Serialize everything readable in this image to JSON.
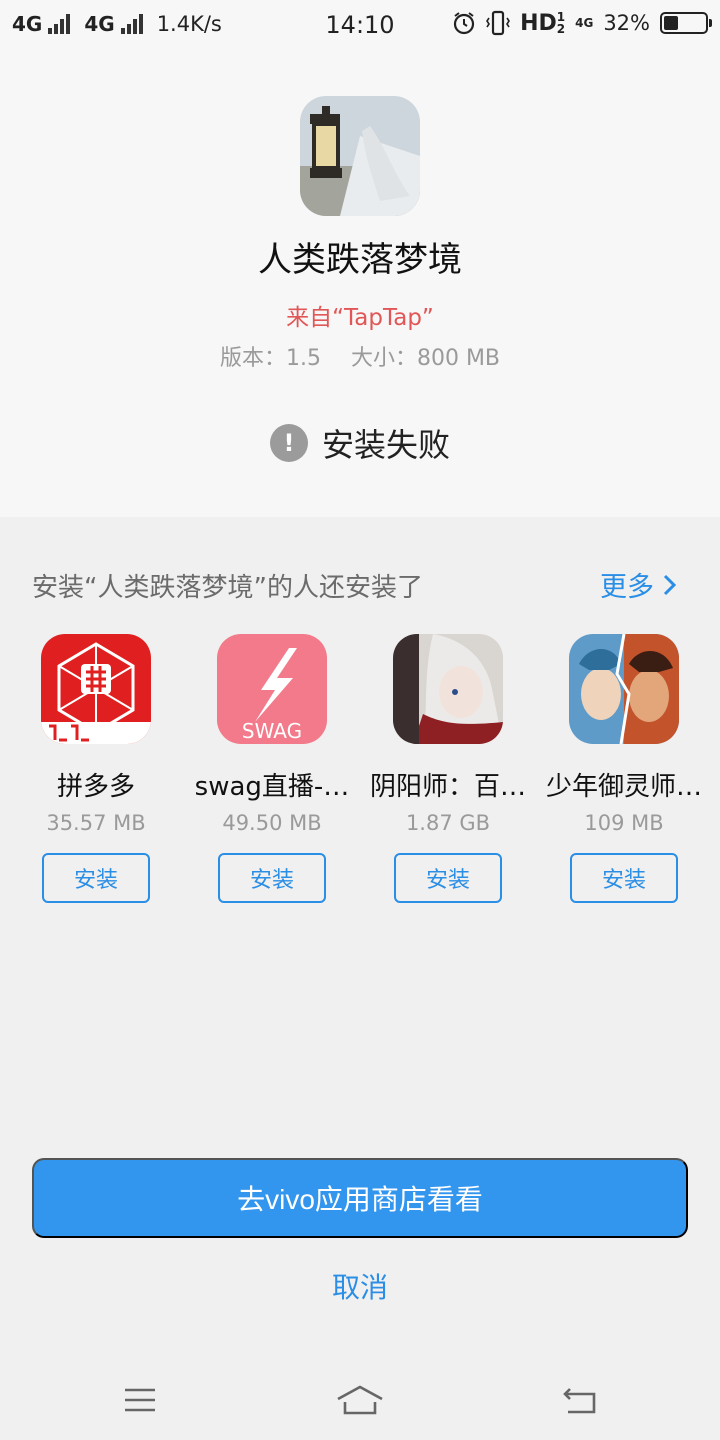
{
  "status_bar": {
    "network1": "4G",
    "network2": "4G",
    "speed": "1.4K/s",
    "time": "14:10",
    "hd": "HD",
    "hd_sub": "1",
    "hd_sub2": "2",
    "net2_label": "4G",
    "battery": "32%",
    "battery_level": 0.32
  },
  "app": {
    "icon": "game-lantern-icon",
    "title": "人类跌落梦境",
    "source": "来自“TapTap”",
    "version": "版本：1.5",
    "size": "大小：800 MB",
    "status_icon": "exclamation-icon",
    "status": "安装失败"
  },
  "recommendations": {
    "header": "安装“人类跌落梦境”的人还安装了",
    "more": "更多",
    "items": [
      {
        "name": "拼多多",
        "size": "35.57 MB",
        "button": "安装",
        "icon": "pinduoduo-icon",
        "color": "#e02020"
      },
      {
        "name": "swag直播-…",
        "size": "49.50 MB",
        "button": "安装",
        "icon": "swag-icon",
        "color": "#f27a8a",
        "icon_text": "SWAG"
      },
      {
        "name": "阴阳师：百…",
        "size": "1.87 GB",
        "button": "安装",
        "icon": "onmyoji-icon",
        "color": "#5a4a4e"
      },
      {
        "name": "少年御灵师…",
        "size": "109 MB",
        "button": "安装",
        "icon": "spirit-master-icon",
        "color": "#4a7fa8"
      }
    ]
  },
  "actions": {
    "store_button": "去vivo应用商店看看",
    "cancel": "取消"
  },
  "navbar": {
    "menu_icon": "menu-icon",
    "home_icon": "home-icon",
    "back_icon": "back-icon"
  },
  "colors": {
    "accent": "#3396ee",
    "source_red": "#e15757"
  }
}
